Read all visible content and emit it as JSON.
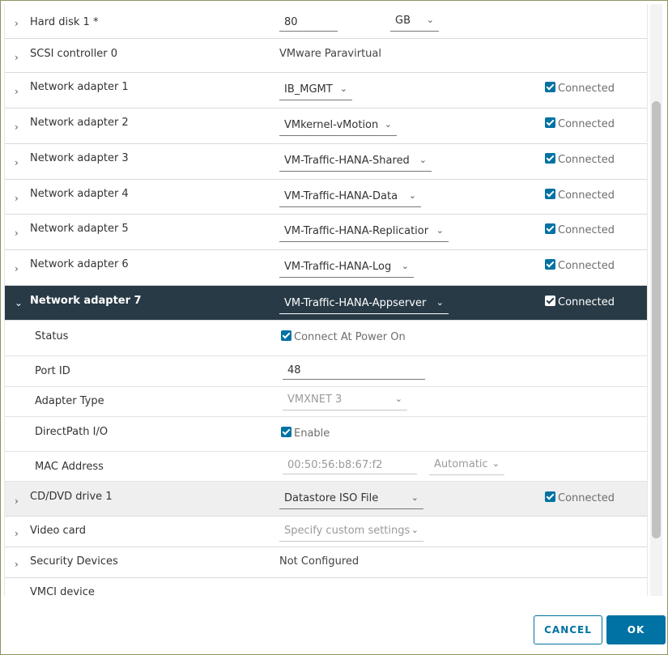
{
  "rows": {
    "hard_disk": {
      "label": "Hard disk 1 *",
      "size_value": "80",
      "unit": "GB"
    },
    "scsi": {
      "label": "SCSI controller 0",
      "value": "VMware Paravirtual"
    },
    "na1": {
      "label": "Network adapter 1",
      "network": "IB_MGMT",
      "connected": "Connected"
    },
    "na2": {
      "label": "Network adapter 2",
      "network": "VMkernel-vMotion",
      "connected": "Connected"
    },
    "na3": {
      "label": "Network adapter 3",
      "network": "VM-Traffic-HANA-Shared",
      "connected": "Connected"
    },
    "na4": {
      "label": "Network adapter 4",
      "network": "VM-Traffic-HANA-Data",
      "connected": "Connected"
    },
    "na5": {
      "label": "Network adapter 5",
      "network": "VM-Traffic-HANA-Replicatior",
      "connected": "Connected"
    },
    "na6": {
      "label": "Network adapter 6",
      "network": "VM-Traffic-HANA-Log",
      "connected": "Connected"
    },
    "na7": {
      "label": "Network adapter 7",
      "network": "VM-Traffic-HANA-Appserver",
      "connected": "Connected",
      "status_label": "Status",
      "status_value": "Connect At Power On",
      "port_id_label": "Port ID",
      "port_id_value": "48",
      "adapter_type_label": "Adapter Type",
      "adapter_type_value": "VMXNET 3",
      "directpath_label": "DirectPath I/O",
      "directpath_value": "Enable",
      "mac_label": "MAC Address",
      "mac_value": "00:50:56:b8:67:f2",
      "mac_mode": "Automatic"
    },
    "cd": {
      "label": "CD/DVD drive 1",
      "source": "Datastore ISO File",
      "connected": "Connected"
    },
    "video": {
      "label": "Video card",
      "value": "Specify custom settings"
    },
    "security": {
      "label": "Security Devices",
      "value": "Not Configured"
    },
    "vmci": {
      "label": "VMCI device"
    }
  },
  "buttons": {
    "cancel": "CANCEL",
    "ok": "OK"
  },
  "icons": {
    "collapsed": "chevron-right-icon",
    "expanded": "chevron-down-icon",
    "dropdown": "caret-down-icon",
    "checkbox": "checkbox-checked-icon"
  },
  "colors": {
    "selected_row": "#283a46",
    "accent": "#0072a3",
    "frame_border": "#8f9662"
  }
}
